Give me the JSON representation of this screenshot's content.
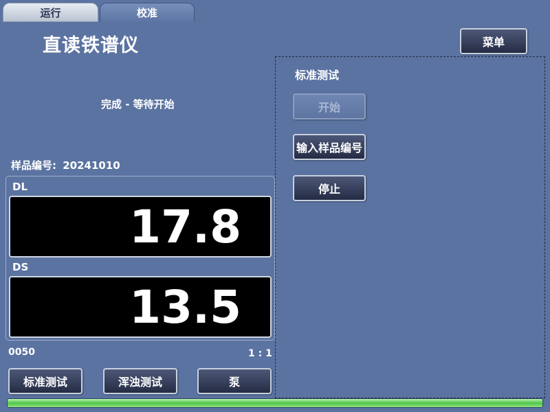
{
  "tabs": [
    {
      "label": "运行",
      "active": true
    },
    {
      "label": "校准",
      "active": false
    }
  ],
  "app_title": "直读铁谱仪",
  "menu_button": "菜单",
  "status": "完成 - 等待开始",
  "sample": {
    "label": "样品编号:",
    "value": "20241010"
  },
  "readings": {
    "dl": {
      "label": "DL",
      "value": "17.8"
    },
    "ds": {
      "label": "DS",
      "value": "13.5"
    }
  },
  "footer": {
    "counter": "0050",
    "ratio": "1 : 1"
  },
  "bottom_buttons": {
    "standard_test": "标准测试",
    "turbidity_test": "浑浊测试",
    "pump": "泵"
  },
  "right_panel": {
    "heading": "标准测试",
    "start_button": "开始",
    "start_enabled": false,
    "input_sample_button": "输入样品编号",
    "stop_button": "停止"
  },
  "progress": {
    "fraction": 1.0
  },
  "colors": {
    "background": "#5b73a1",
    "display_bg": "#000000",
    "progress_green": "#52c64a"
  }
}
